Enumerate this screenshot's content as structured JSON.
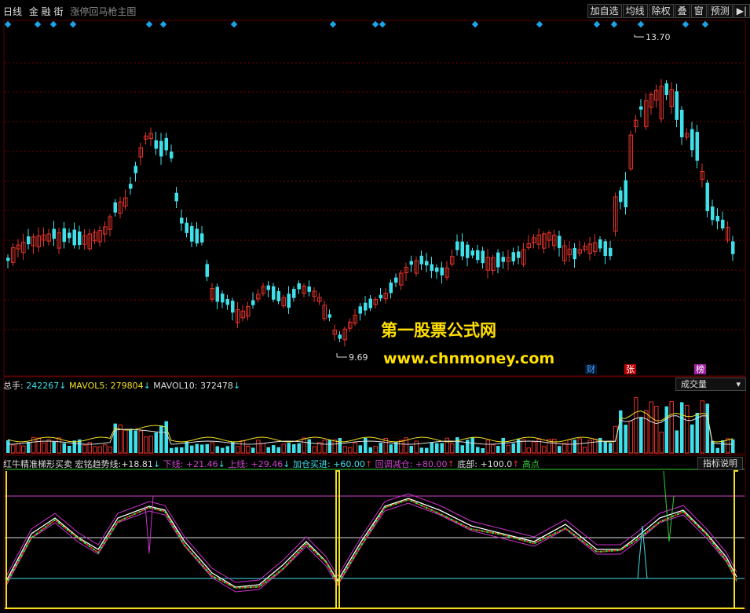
{
  "toolbar": {
    "period": "日线",
    "stock_name": "金 融 街",
    "formula_name": "涨停回马枪主图",
    "buttons": [
      "加自选",
      "均线",
      "除权",
      "叠",
      "窗",
      "预测"
    ],
    "expand_icon": "play-left-icon"
  },
  "main_chart": {
    "high_label": "13.70",
    "low_label": "9.69",
    "markers": {
      "cai": "财",
      "zhang": "张",
      "bang": "榜"
    },
    "signal_color": "#1ca3e6"
  },
  "watermark": {
    "line1": "第一股票公式网",
    "line2": "www.chnmoney.com"
  },
  "volume_panel": {
    "total_label": "总手:",
    "total_value": "242267",
    "mavol5_label": "MAVOL5:",
    "mavol5_value": "279804",
    "mavol10_label": "MAVOL10:",
    "mavol10_value": "372478",
    "arrow_down": "↓",
    "selector_label": "成交量",
    "selector_icon": "triangle-down-icon"
  },
  "indicator_panel": {
    "name": "红牛精准梯形买卖",
    "trend_label": "宏铭趋势线:",
    "trend_value": "+18.81",
    "lower_label": "下线:",
    "lower_value": "+21.46",
    "upper_label": "上线:",
    "upper_value": "+29.46",
    "add_label": "加仓买进:",
    "add_value": "+60.00",
    "reduce_label": "回调减仓:",
    "reduce_value": "+80.00",
    "bottom_label": "底部:",
    "bottom_value": "+100.0",
    "high_label": "高点",
    "arrow_down": "↓",
    "arrow_up": "↑",
    "help_button": "指标说明"
  },
  "colors": {
    "up": "#e2322a",
    "down": "#3fe0ea",
    "grid": "#7a0000",
    "yellow": "#f0e020",
    "magenta": "#cc33cc",
    "green": "#33cc33"
  }
}
